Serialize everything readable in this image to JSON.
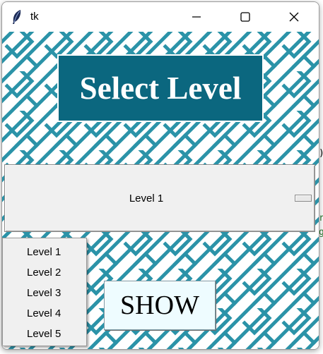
{
  "window": {
    "title": "tk",
    "icon": "feather-icon",
    "controls": [
      "minimize-icon",
      "maximize-icon",
      "close-icon"
    ]
  },
  "banner": {
    "text": "Select Level",
    "color": "#0b677f"
  },
  "level_select": {
    "selected": "Level 1",
    "options": [
      "Level 1",
      "Level 2",
      "Level 3",
      "Level 4",
      "Level 5"
    ]
  },
  "show_button": {
    "label": "SHOW"
  },
  "background_glyphs": [
    ")",
    "r",
    "g"
  ],
  "colors": {
    "pattern": "#2b93a8",
    "accent": "#0b677f",
    "button_bg": "#eefcff"
  }
}
